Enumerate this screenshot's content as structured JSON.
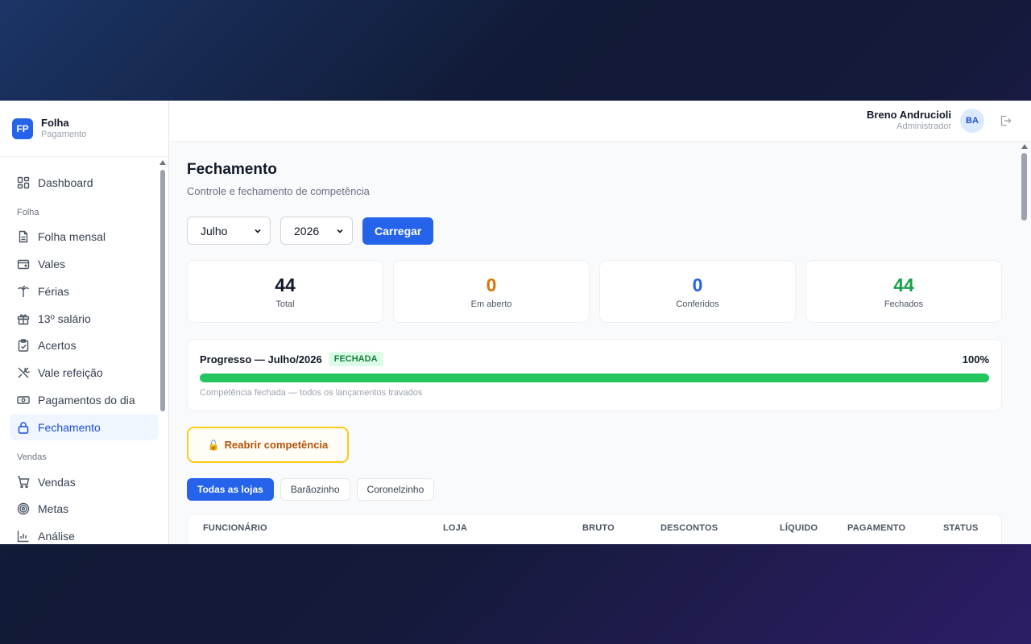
{
  "brand": {
    "logo": "FP",
    "name": "Folha",
    "subtitle": "Pagamento"
  },
  "sidebar": {
    "items_top": [
      {
        "label": "Dashboard",
        "icon": "dashboard-icon"
      }
    ],
    "section_folha": "Folha",
    "items_folha": [
      {
        "label": "Folha mensal",
        "icon": "document-icon"
      },
      {
        "label": "Vales",
        "icon": "wallet-icon"
      },
      {
        "label": "Férias",
        "icon": "palm-tree-icon"
      },
      {
        "label": "13º salário",
        "icon": "gift-icon"
      },
      {
        "label": "Acertos",
        "icon": "clipboard-check-icon"
      },
      {
        "label": "Vale refeição",
        "icon": "utensils-icon"
      },
      {
        "label": "Pagamentos do dia",
        "icon": "banknote-icon"
      },
      {
        "label": "Fechamento",
        "icon": "lock-icon",
        "active": true
      }
    ],
    "section_vendas": "Vendas",
    "items_vendas": [
      {
        "label": "Vendas",
        "icon": "cart-icon"
      },
      {
        "label": "Metas",
        "icon": "target-icon"
      },
      {
        "label": "Análise",
        "icon": "bar-chart-icon"
      }
    ]
  },
  "header": {
    "user_name": "Breno Andrucioli",
    "user_role": "Administrador",
    "avatar": "BA"
  },
  "page": {
    "title": "Fechamento",
    "subtitle": "Controle e fechamento de competência"
  },
  "filters": {
    "month": "Julho",
    "year": "2026",
    "load_label": "Carregar"
  },
  "stats": [
    {
      "value": "44",
      "label": "Total",
      "color": "#111827"
    },
    {
      "value": "0",
      "label": "Em aberto",
      "color": "#d97706"
    },
    {
      "value": "0",
      "label": "Conferidos",
      "color": "#2563eb"
    },
    {
      "value": "44",
      "label": "Fechados",
      "color": "#16a34a"
    }
  ],
  "progress": {
    "title": "Progresso — Julho/2026",
    "badge": "FECHADA",
    "percent_label": "100%",
    "percent": 100,
    "note": "Competência fechada — todos os lançamentos travados"
  },
  "reopen": {
    "icon": "🔓",
    "label": "Reabrir competência"
  },
  "store_tabs": [
    {
      "label": "Todas as lojas",
      "active": true
    },
    {
      "label": "Barãozinho",
      "active": false
    },
    {
      "label": "Coronelzinho",
      "active": false
    }
  ],
  "table": {
    "columns": [
      "FUNCIONÁRIO",
      "LOJA",
      "BRUTO",
      "DESCONTOS",
      "LÍQUIDO",
      "PAGAMENTO",
      "STATUS"
    ]
  },
  "colors": {
    "accent": "#2563eb",
    "success": "#22c55e",
    "warning": "#facc15"
  }
}
